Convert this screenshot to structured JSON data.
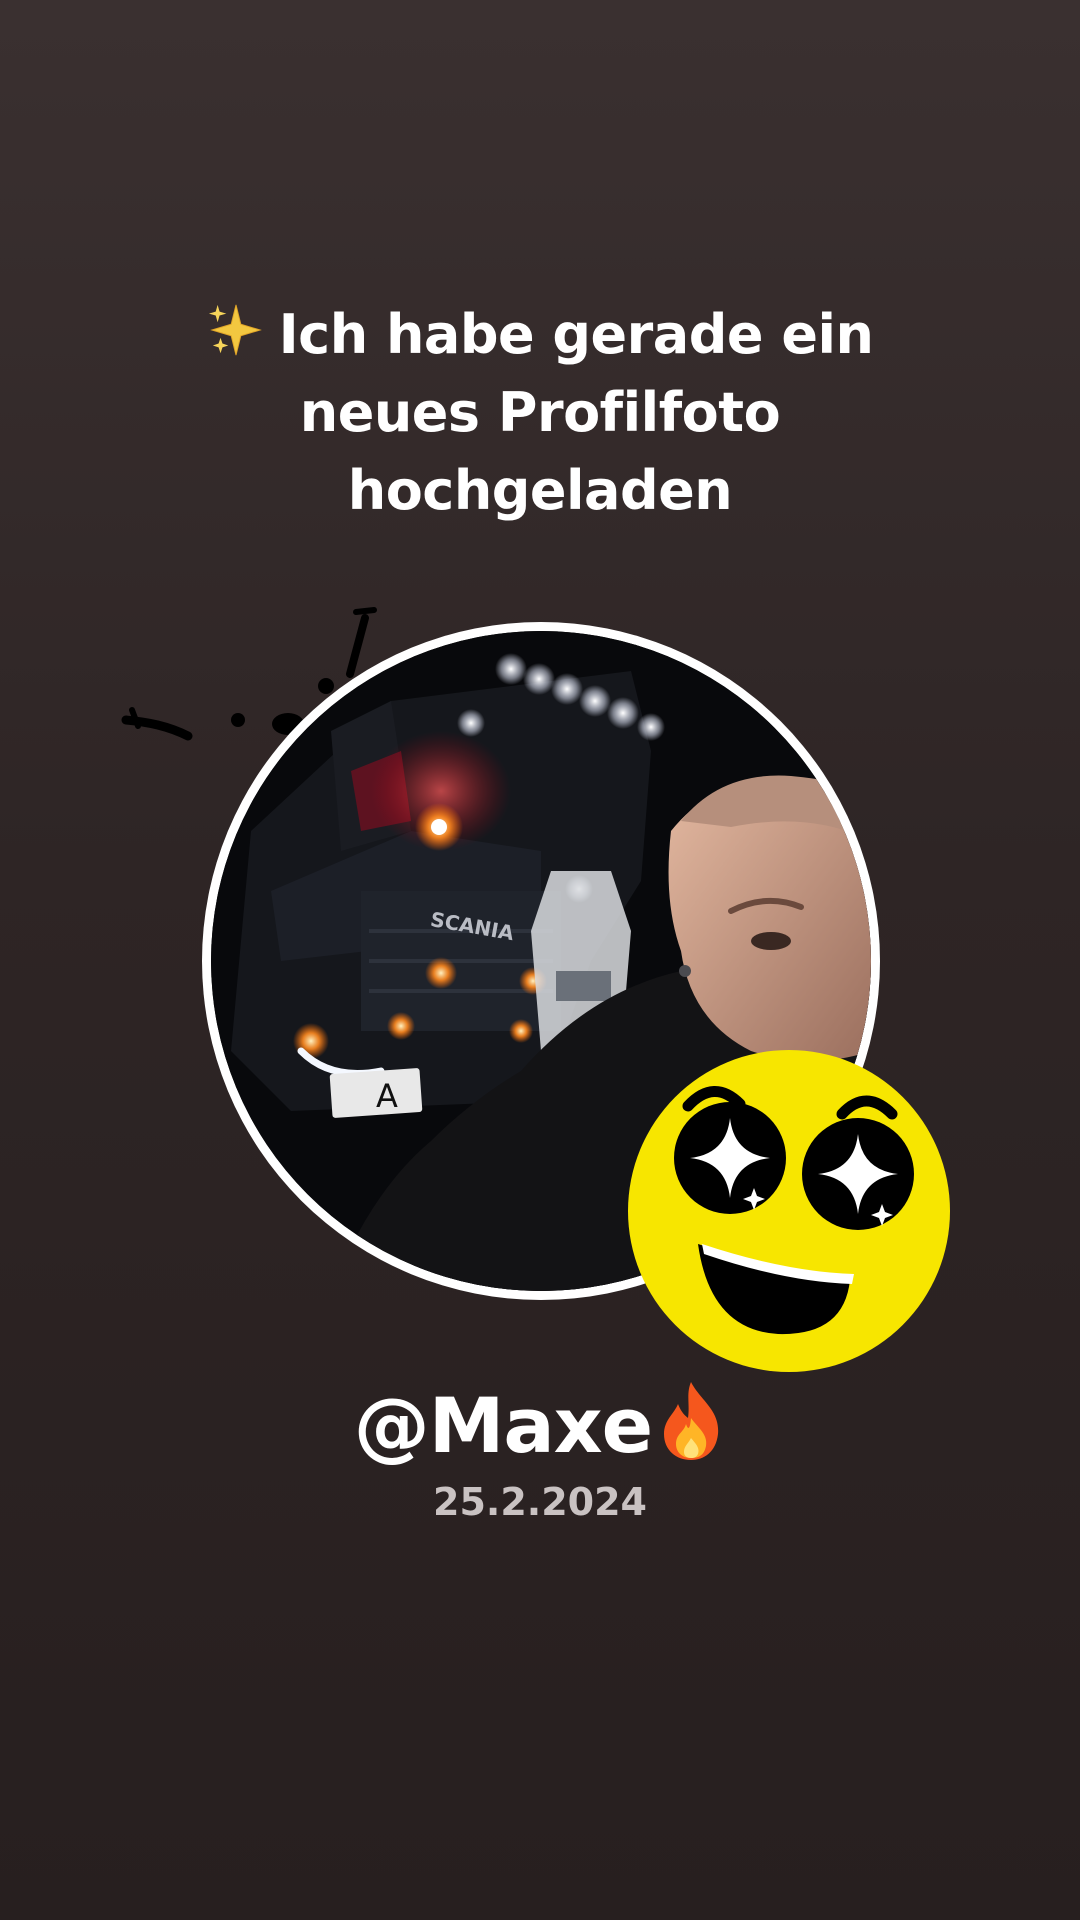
{
  "post": {
    "headline_lines": [
      "Ich habe gerade ein",
      "neues Profilfoto",
      "hochgeladen"
    ],
    "headline_emoji": "sparkles-icon",
    "username": "@Maxe",
    "username_emoji": "fire-icon",
    "date": "25.2.2024"
  },
  "photo": {
    "plate_letter": "A",
    "truck_badge": "SCANIA"
  },
  "sticker": {
    "icon": "star-struck-face-icon"
  },
  "colors": {
    "background": "#2f2626",
    "text": "#ffffff",
    "date_text": "#c9c2c2",
    "emoji_yellow": "#f7e600"
  }
}
